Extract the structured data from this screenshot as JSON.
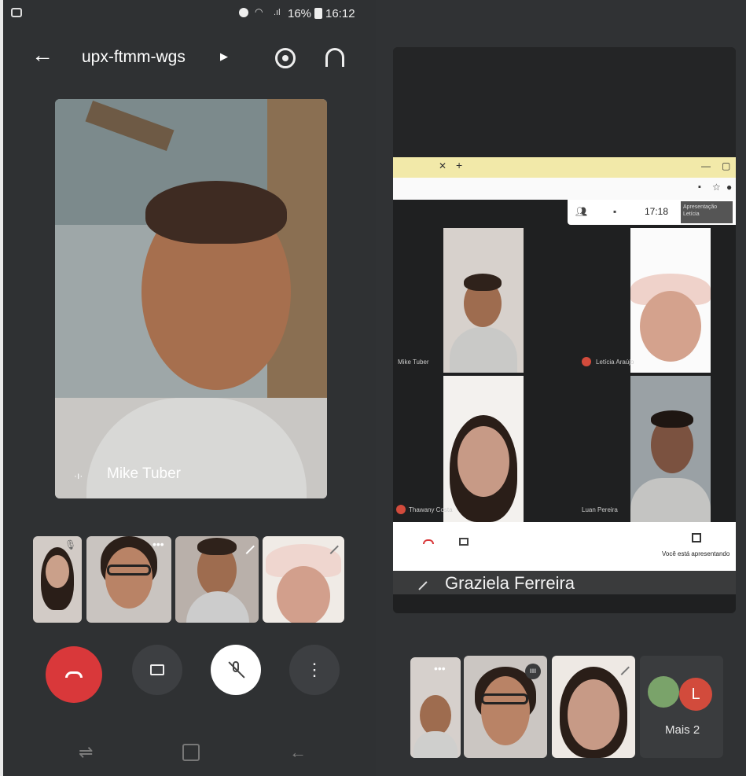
{
  "status_bar": {
    "battery": "16%",
    "time": "16:12"
  },
  "header": {
    "meeting_code": "upx-ftmm-wgs"
  },
  "main_video": {
    "participant_name": "Mike Tuber"
  },
  "controls": [
    "end-call",
    "camera",
    "mic-off",
    "more"
  ],
  "shared_screen": {
    "clock": "17:18",
    "status_line": "Apresentação\nLetícia",
    "tiles": [
      {
        "name": "Mike Tuber"
      },
      {
        "name": "Letícia Araújo"
      },
      {
        "name": "Thawany Costa"
      },
      {
        "name": "Luan Pereira"
      }
    ],
    "presenting_label": "Você está apresentando",
    "speaker_name": "Graziela Ferreira"
  },
  "more_tile": {
    "label": "Mais 2",
    "avatar_letter": "L"
  },
  "colors": {
    "end_call": "#d9383a",
    "dark_bg": "#2f3133",
    "accent_avatar": "#d24b3c"
  }
}
